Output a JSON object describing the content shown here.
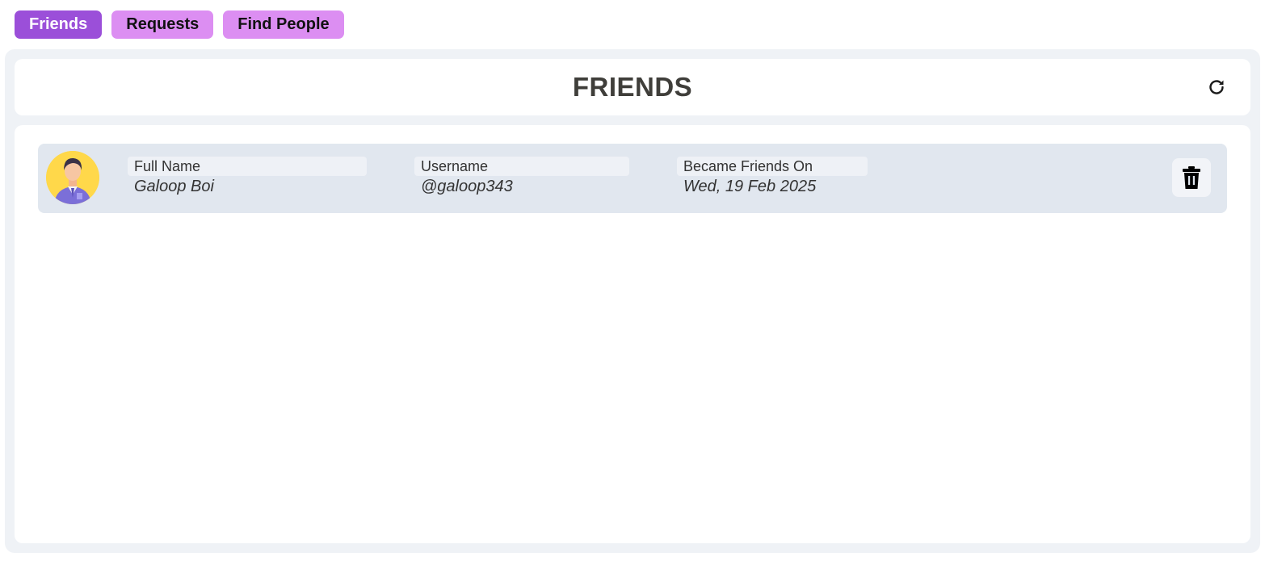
{
  "tabs": [
    {
      "label": "Friends",
      "active": true
    },
    {
      "label": "Requests",
      "active": false
    },
    {
      "label": "Find People",
      "active": false
    }
  ],
  "header": {
    "title": "FRIENDS",
    "refresh_icon": "refresh-icon"
  },
  "friends": [
    {
      "avatar_icon": "person-avatar",
      "full_name_label": "Full Name",
      "full_name": "Galoop Boi",
      "username_label": "Username",
      "username": "@galoop343",
      "since_label": "Became Friends On",
      "since": "Wed, 19 Feb 2025",
      "delete_icon": "trash-icon"
    }
  ],
  "colors": {
    "tab_active": "#9b4fd9",
    "tab_inactive": "#dc8ef2",
    "panel_bg": "#eff2f6",
    "row_bg": "#e1e7ef",
    "title_text": "#3f3e3a"
  }
}
